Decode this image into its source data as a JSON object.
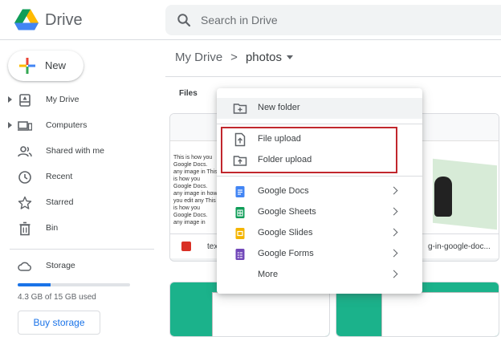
{
  "app": {
    "name": "Drive"
  },
  "search": {
    "placeholder": "Search in Drive",
    "icon": "search-icon"
  },
  "sidebar": {
    "new_label": "New",
    "items": [
      {
        "label": "My Drive",
        "icon": "my-drive-icon",
        "expandable": true
      },
      {
        "label": "Computers",
        "icon": "computers-icon",
        "expandable": true
      },
      {
        "label": "Shared with me",
        "icon": "shared-icon",
        "expandable": false
      },
      {
        "label": "Recent",
        "icon": "clock-icon",
        "expandable": false
      },
      {
        "label": "Starred",
        "icon": "star-icon",
        "expandable": false
      },
      {
        "label": "Bin",
        "icon": "trash-icon",
        "expandable": false
      }
    ],
    "storage": {
      "label": "Storage",
      "used_text": "4.3 GB of 15 GB used",
      "fraction": 0.29
    },
    "buy_storage_label": "Buy storage"
  },
  "breadcrumb": {
    "root": "My Drive",
    "separator": ">",
    "current": "photos"
  },
  "files": {
    "section_label": "Files",
    "cards": [
      {
        "name": "tex",
        "doc_lines": "This is how you Google Docs. any image in This is how you Google Docs. any image in how you edit any This is how you Google Docs. any image in"
      },
      {
        "name": "g-in-google-doc..."
      }
    ]
  },
  "menu": {
    "items": [
      {
        "label": "New folder",
        "icon": "new-folder-icon",
        "submenu": false
      },
      {
        "label": "File upload",
        "icon": "file-upload-icon",
        "submenu": false
      },
      {
        "label": "Folder upload",
        "icon": "folder-upload-icon",
        "submenu": false
      },
      {
        "label": "Google Docs",
        "icon": "google-docs-icon",
        "submenu": true
      },
      {
        "label": "Google Sheets",
        "icon": "google-sheets-icon",
        "submenu": true
      },
      {
        "label": "Google Slides",
        "icon": "google-slides-icon",
        "submenu": true
      },
      {
        "label": "Google Forms",
        "icon": "google-forms-icon",
        "submenu": true
      },
      {
        "label": "More",
        "icon": "",
        "submenu": true
      }
    ]
  },
  "colors": {
    "accent": "#1a73e8",
    "highlight_box": "#c1272d",
    "docs": "#4285f4",
    "sheets": "#0f9d58",
    "slides": "#f4b400",
    "forms": "#7248b9"
  }
}
